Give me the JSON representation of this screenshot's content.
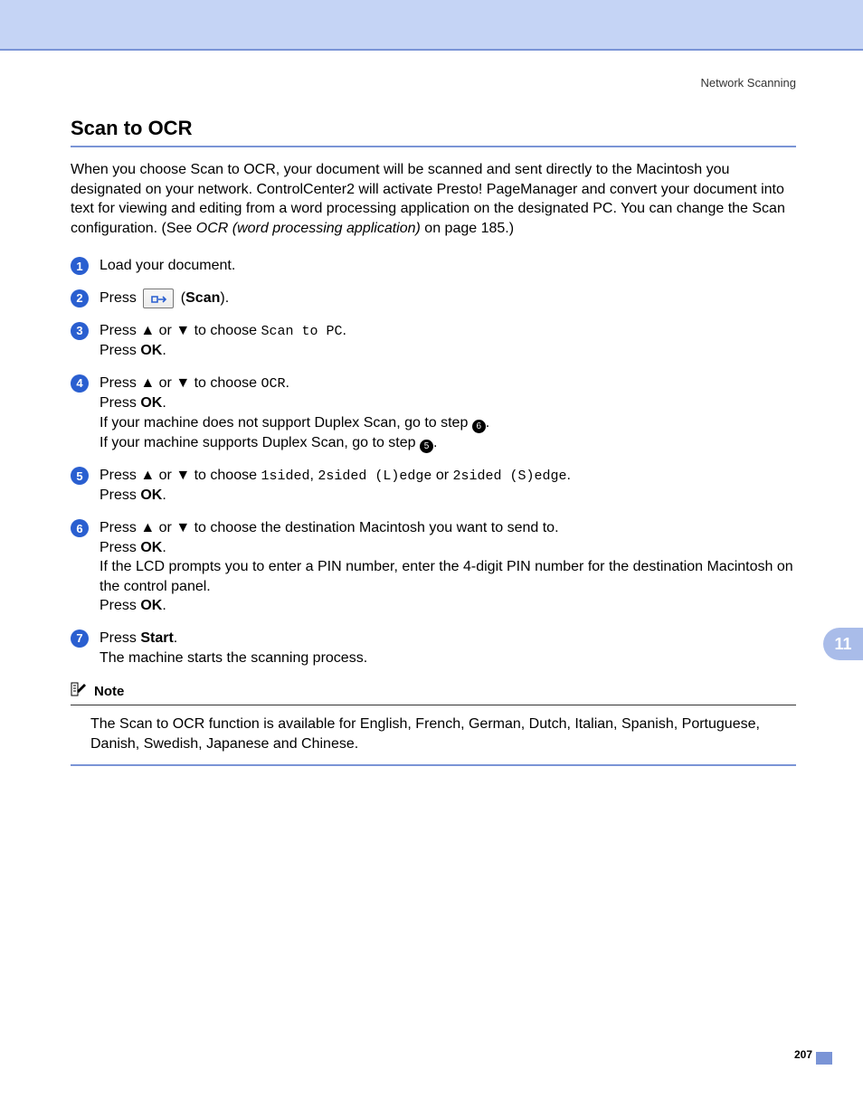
{
  "breadcrumb": "Network Scanning",
  "title": "Scan to OCR",
  "intro_prefix": "When you choose Scan to OCR, your document will be scanned and sent directly to the Macintosh you designated on your network. ControlCenter2 will activate Presto! PageManager and convert your document into text for viewing and editing from a word processing application on the designated PC. You can change the Scan configuration. (See ",
  "intro_ref": "OCR (word processing application)",
  "intro_suffix": " on page 185.)",
  "steps": {
    "s1": "Load your document.",
    "s2_press": "Press ",
    "s2_paren_open": " (",
    "s2_scan": "Scan",
    "s2_paren_close": ").",
    "s3_a": "Press ",
    "s3_or": " or ",
    "s3_choose": " to choose ",
    "s3_code": "Scan to PC",
    "s3_dot": ".",
    "s3_press_ok": "Press ",
    "s3_ok": "OK",
    "s3_end": ".",
    "s4_a": "Press ",
    "s4_or": " or ",
    "s4_choose": " to choose ",
    "s4_code": "OCR",
    "s4_dot": ".",
    "s4_press_ok": "Press ",
    "s4_ok": "OK",
    "s4_end": ".",
    "s4_noduplex": "If your machine does not support Duplex Scan, go to step ",
    "s4_noduplex_end": ".",
    "s4_duplex": "If your machine supports Duplex Scan, go to step ",
    "s4_duplex_end": ".",
    "s5_a": "Press ",
    "s5_or": " or ",
    "s5_choose": " to choose ",
    "s5_c1": "1sided",
    "s5_sep1": ", ",
    "s5_c2": "2sided (L)edge",
    "s5_sep2": " or ",
    "s5_c3": "2sided (S)edge",
    "s5_dot": ".",
    "s5_press_ok": "Press ",
    "s5_ok": "OK",
    "s5_end": ".",
    "s6_a": "Press ",
    "s6_or": " or ",
    "s6_choose": " to choose the destination Macintosh you want to send to.",
    "s6_press_ok": "Press ",
    "s6_ok": "OK",
    "s6_end": ".",
    "s6_pin": "If the LCD prompts you to enter a PIN number, enter the 4-digit PIN number for the destination Macintosh on the control panel.",
    "s6_press_ok2": "Press ",
    "s6_ok2": "OK",
    "s6_end2": ".",
    "s7_press": "Press ",
    "s7_start": "Start",
    "s7_dot": ".",
    "s7_line2": "The machine starts the scanning process."
  },
  "inline_refs": {
    "ref6": "6",
    "ref5": "5"
  },
  "note": {
    "label": "Note",
    "body": "The Scan to OCR function is available for English, French, German, Dutch, Italian, Spanish, Portuguese, Danish, Swedish, Japanese and Chinese."
  },
  "tab": "11",
  "page_number": "207",
  "glyphs": {
    "up": "▲",
    "down": "▼"
  }
}
